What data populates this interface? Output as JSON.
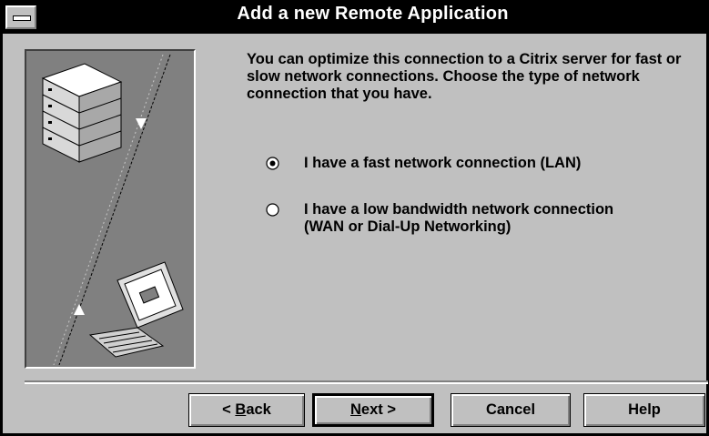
{
  "window": {
    "title": "Add a new Remote Application"
  },
  "content": {
    "description": "You can optimize this connection to a Citrix server for fast or slow network connections.  Choose the type of network connection that you have.",
    "options": [
      {
        "label": "I have a fast network connection (LAN)",
        "selected": true
      },
      {
        "label_line1": "I have a low bandwidth network connection",
        "label_line2": "(WAN or Dial-Up Networking)",
        "selected": false
      }
    ]
  },
  "buttons": {
    "back": {
      "prefix": "< ",
      "mnemonic": "B",
      "rest": "ack"
    },
    "next": {
      "mnemonic": "N",
      "rest": "ext >"
    },
    "cancel": "Cancel",
    "help": "Help"
  },
  "colors": {
    "face": "#c0c0c0",
    "shadow": "#808080",
    "titlebar": "#000000"
  }
}
